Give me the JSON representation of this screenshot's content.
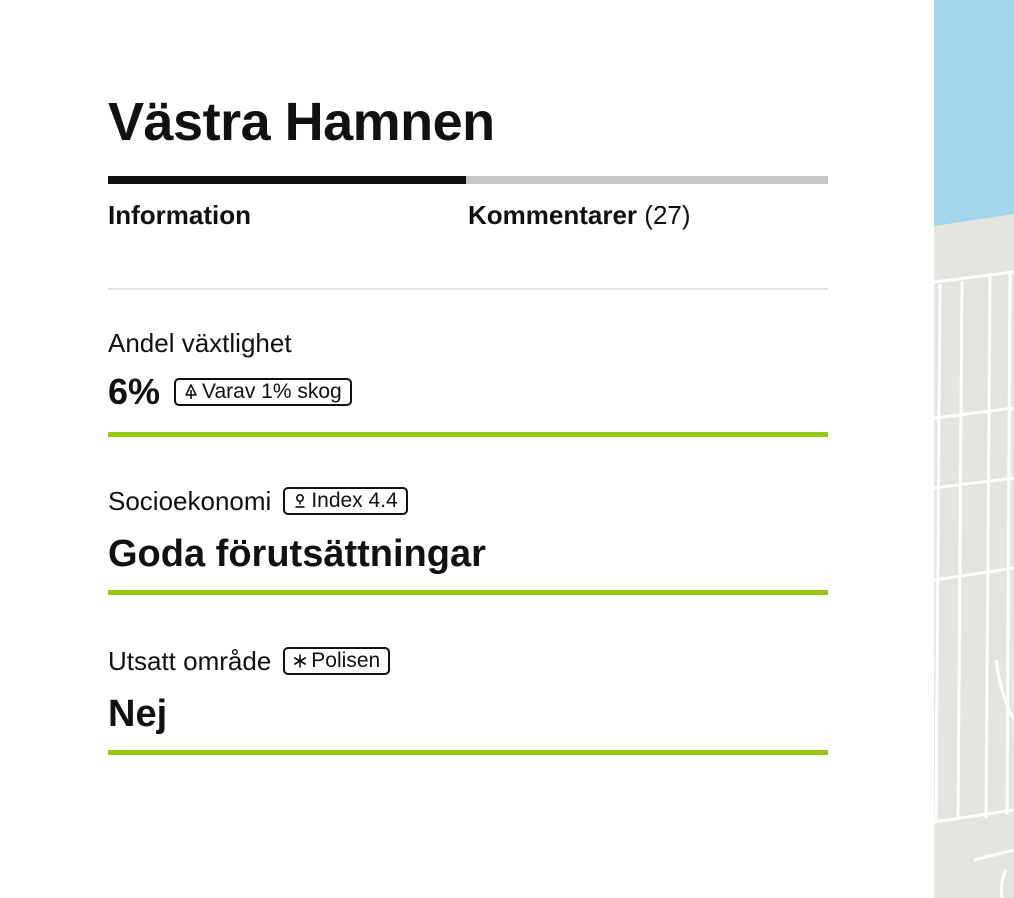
{
  "area": {
    "title": "Västra Hamnen"
  },
  "tabs": {
    "information_label": "Information",
    "comments_label": "Kommentarer",
    "comments_count": "(27)"
  },
  "sections": {
    "vegetation": {
      "label": "Andel växtlighet",
      "value": "6%",
      "badge_text": "Varav 1% skog",
      "badge_icon": "tree-icon"
    },
    "socioeconomy": {
      "label": "Socioekonomi",
      "badge_text": "Index 4.4",
      "badge_icon": "person-icon",
      "value": "Goda förutsättningar"
    },
    "vulnerable": {
      "label": "Utsatt område",
      "badge_text": "Polisen",
      "badge_icon": "asterisk-icon",
      "value": "Nej"
    }
  },
  "colors": {
    "accent_green": "#95c80f",
    "tab_active": "#111111",
    "tab_inactive": "#c6c6c6",
    "map_water": "#a1d6ec",
    "map_land": "#e6e4e1"
  }
}
